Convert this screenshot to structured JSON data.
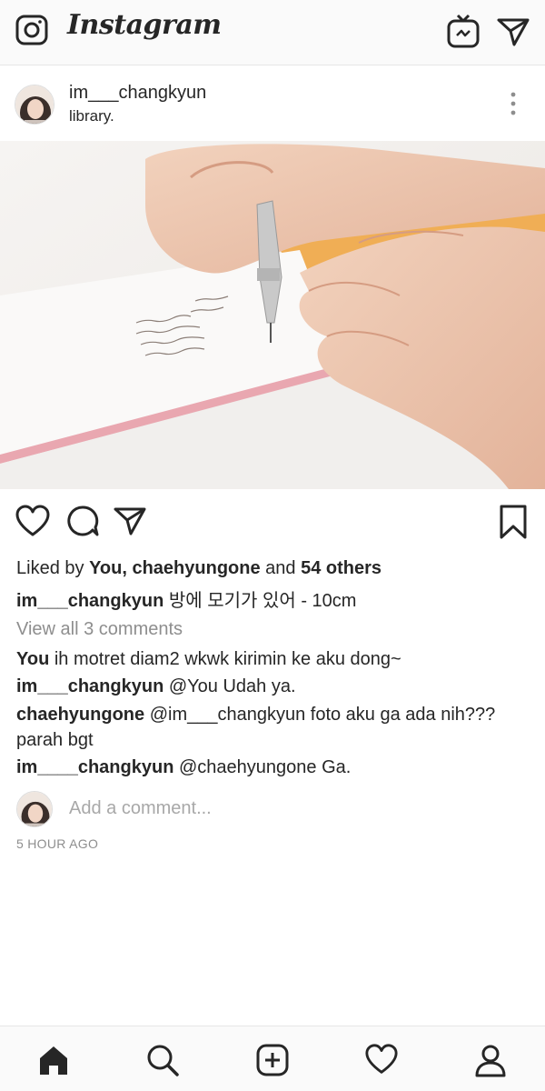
{
  "app": {
    "brand": "Instagram"
  },
  "header": {
    "icons": [
      "camera-icon",
      "igtv-icon",
      "direct-message-icon"
    ]
  },
  "post": {
    "username": "im___changkyun",
    "location": "library.",
    "liked_prefix": "Liked by ",
    "liked_users": "You, chaehyungone",
    "liked_and": " and ",
    "liked_others": "54 others",
    "caption_user": "im___changkyun",
    "caption_text": " 방에 모기가 있어 - 10cm",
    "view_all": "View all 3 comments",
    "comments": [
      {
        "user": "You",
        "text": " ih motret diam2 wkwk kirimin ke aku dong~"
      },
      {
        "user": "im___changkyun",
        "text": " @You Udah ya."
      },
      {
        "user": "chaehyungone",
        "text": " @im___changkyun foto aku ga ada nih??? parah bgt"
      },
      {
        "user": "im____changkyun",
        "text": " @chaehyungone Ga."
      }
    ],
    "add_comment_placeholder": "Add a comment...",
    "time": "5 HOUR AGO"
  },
  "bottom_nav": [
    "home-icon",
    "search-icon",
    "new-post-icon",
    "activity-heart-icon",
    "profile-icon"
  ]
}
